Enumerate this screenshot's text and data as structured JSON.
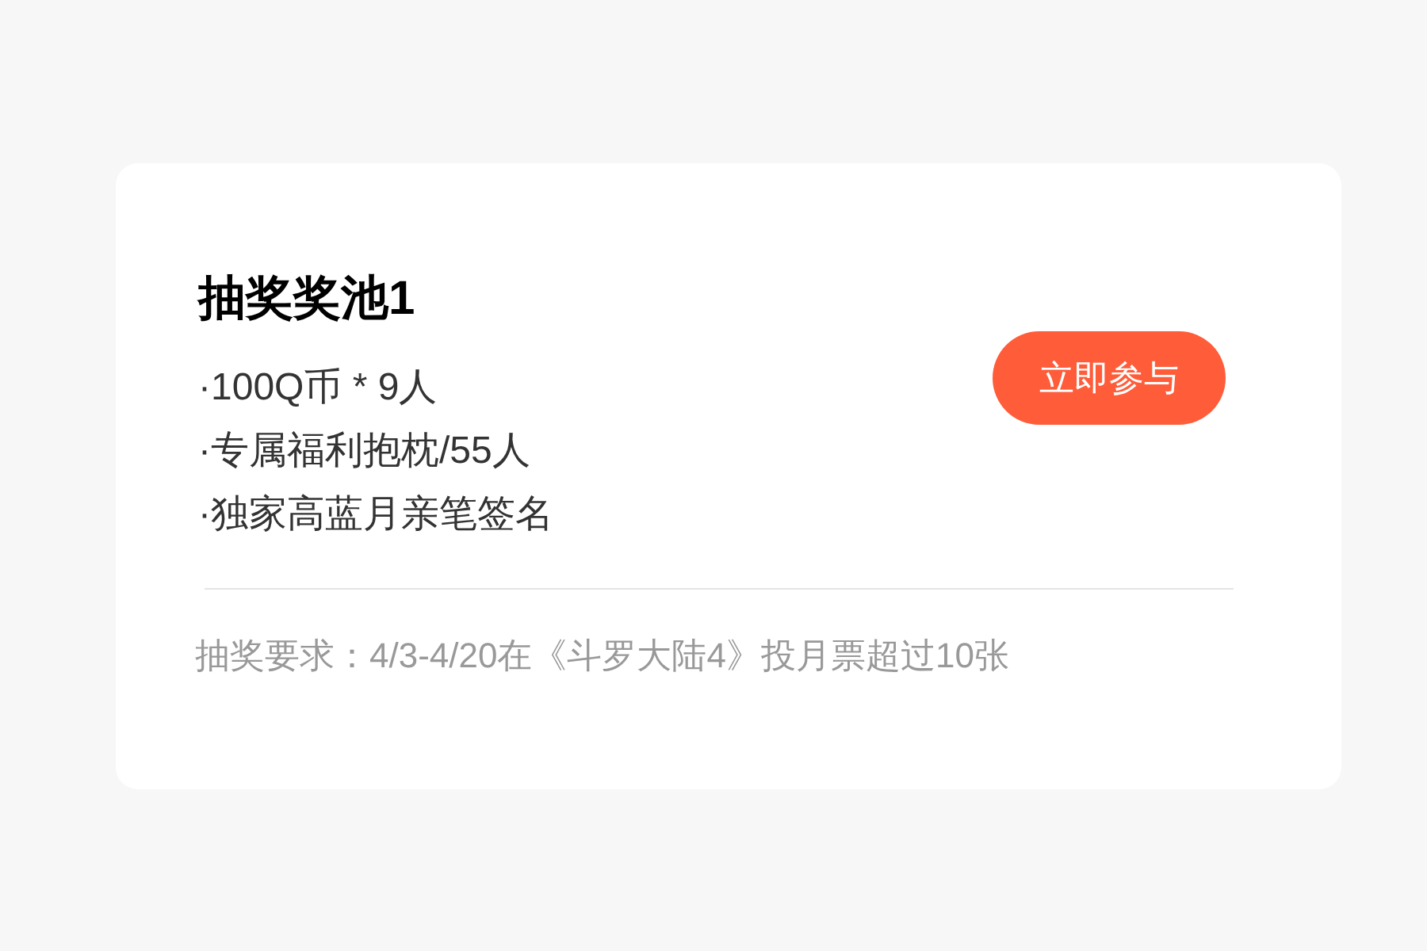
{
  "card": {
    "title": "抽奖奖池1",
    "prizes": [
      "·100Q币 * 9人",
      "·专属福利抱枕/55人",
      "·独家高蓝月亲笔签名"
    ],
    "join_button": "立即参与",
    "requirement": "抽奖要求：4/3-4/20在《斗罗大陆4》投月票超过10张"
  }
}
